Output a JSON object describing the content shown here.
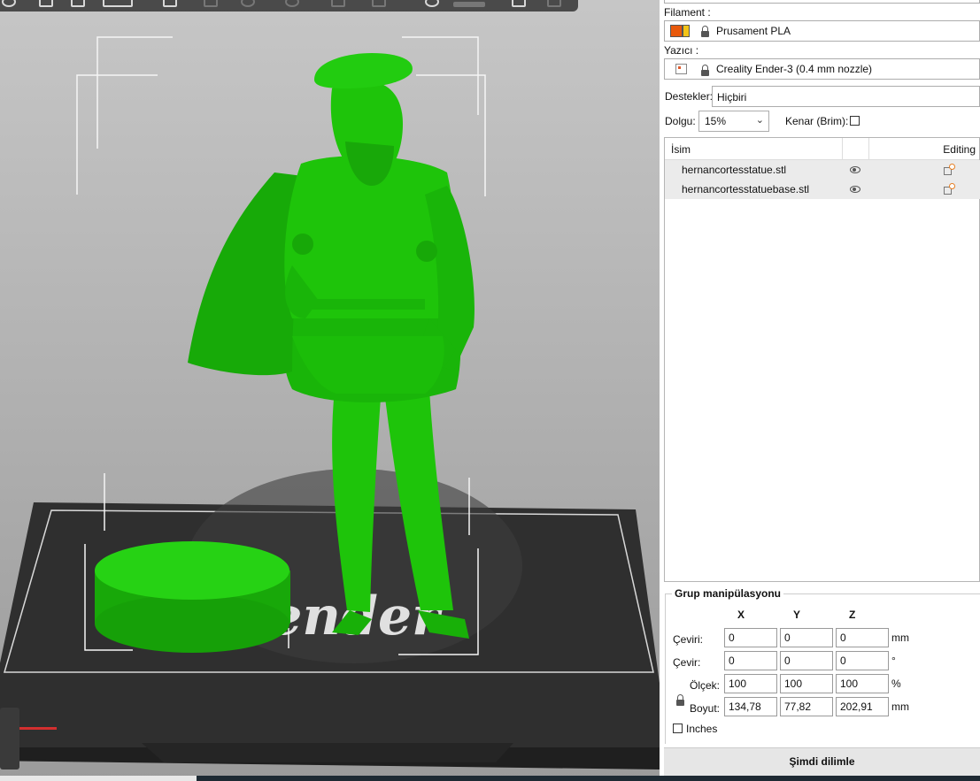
{
  "panel": {
    "filament_label": "Filament :",
    "filament_value": "Prusament PLA",
    "printer_label": "Yazıcı :",
    "printer_value": "Creality Ender-3 (0.4 mm nozzle)",
    "supports_label": "Destekler:",
    "supports_value": "Hiçbiri",
    "infill_label": "Dolgu:",
    "infill_value": "15%",
    "brim_label": "Kenar (Brim):"
  },
  "object_list": {
    "header_name": "İsim",
    "header_editing": "Editing",
    "items": [
      {
        "name": "hernancortesstatue.stl"
      },
      {
        "name": "hernancortesstatuebase.stl"
      }
    ]
  },
  "manipulation": {
    "title": "Grup manipülasyonu",
    "axes": [
      "X",
      "Y",
      "Z"
    ],
    "rows": [
      {
        "label": "Çeviri:",
        "values": [
          "0",
          "0",
          "0"
        ],
        "unit": "mm"
      },
      {
        "label": "Çevir:",
        "values": [
          "0",
          "0",
          "0"
        ],
        "unit": "°"
      },
      {
        "label": "Ölçek:",
        "values": [
          "100",
          "100",
          "100"
        ],
        "unit": "%"
      },
      {
        "label": "Boyut:",
        "values": [
          "134,78",
          "77,82",
          "202,91"
        ],
        "unit": "mm"
      }
    ],
    "inches_label": "Inches"
  },
  "slice_button": "Şimdi dilimle",
  "viewport": {
    "bed_logo_text": "ender"
  },
  "colors": {
    "model": "#1ec40a",
    "bed": "#2e2e2e",
    "filament_swatch": "#e8590c",
    "filament_swatch_2": "#f2c418"
  }
}
